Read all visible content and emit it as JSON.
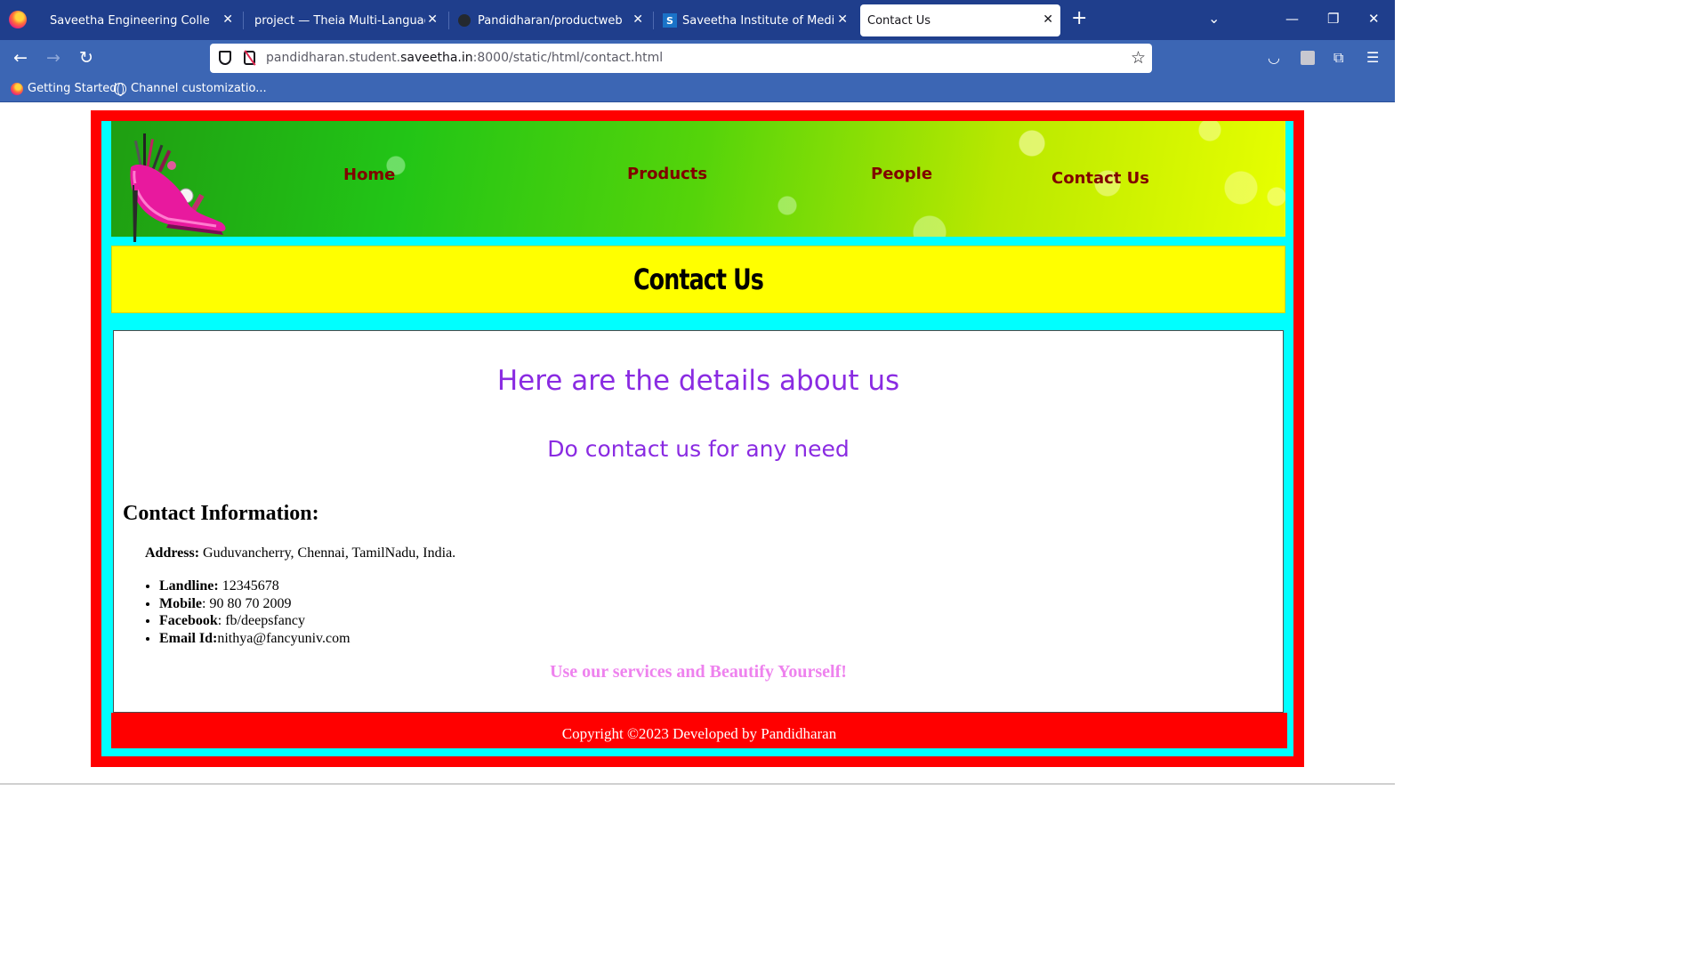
{
  "browser": {
    "tabs": [
      {
        "title": "Saveetha Engineering College",
        "icon": "firefox-tab-icon",
        "active": false
      },
      {
        "title": "project — Theia Multi-Language Ex",
        "icon": "none",
        "active": false
      },
      {
        "title": "Pandidharan/productweb",
        "icon": "github-icon",
        "active": false
      },
      {
        "title": "Saveetha Institute of Medical Ar",
        "icon": "s-favicon",
        "active": false
      },
      {
        "title": "Contact Us",
        "icon": "none",
        "active": true
      }
    ],
    "url": {
      "prefix": "pandidharan.student.",
      "host": "saveetha.in",
      "suffix": ":8000/static/html/contact.html"
    },
    "bookmarks": [
      {
        "label": "Getting Started"
      },
      {
        "label": "Channel customizatio..."
      }
    ],
    "colors": {
      "tabbar": "#1f3e8c",
      "toolbar": "#3c66b4"
    }
  },
  "site": {
    "nav": [
      {
        "label": "Home"
      },
      {
        "label": "Products"
      },
      {
        "label": "People"
      },
      {
        "label": "Contact Us"
      }
    ],
    "page_title": "Contact Us",
    "heading_details": "Here are the details about us",
    "heading_contact": "Do contact us for any need",
    "info_heading": "Contact Information:",
    "address": {
      "label": "Address:",
      "value": " Guduvancherry, Chennai, TamilNadu, India."
    },
    "contacts": [
      {
        "label": "Landline:",
        "value": " 12345678"
      },
      {
        "label": "Mobile",
        "value": ": 90 80 70 2009"
      },
      {
        "label": "Facebook",
        "value": ": fb/deepsfancy"
      },
      {
        "label": "Email Id:",
        "value": "nithya@fancyuniv.com"
      }
    ],
    "tagline": "Use our services and Beautify Yourself!",
    "footer": "Copyright ©2023 Developed by Pandidharan",
    "colors": {
      "outer_border": "#ff0000",
      "inner_border": "#00ffff",
      "title_band": "#ffff00",
      "nav_text": "#800000",
      "headings": "#8a2be2",
      "tagline": "#ee82ee",
      "footer": "#ff0000"
    }
  }
}
